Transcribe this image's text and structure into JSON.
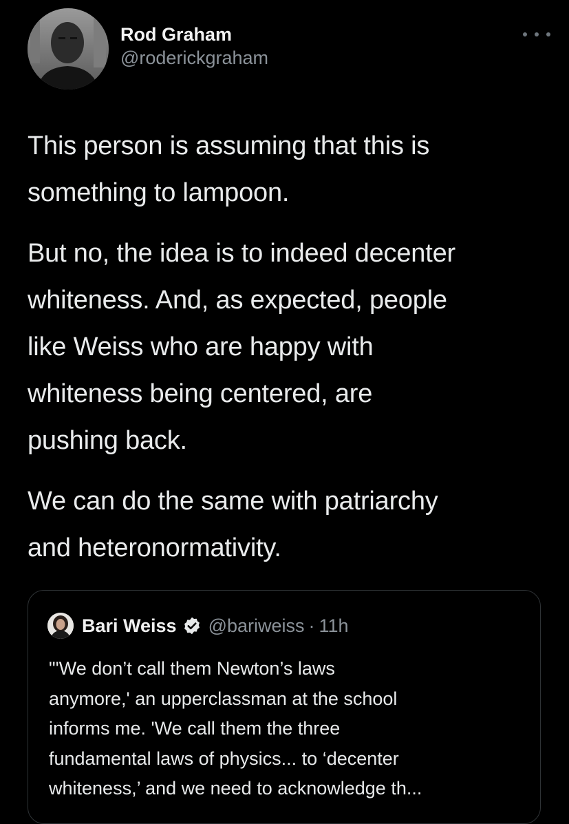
{
  "tweet": {
    "author": {
      "display_name": "Rod Graham",
      "handle": "@roderickgraham",
      "avatar_icon": "profile-photo"
    },
    "more_icon": "more-horizontal-icon",
    "paragraphs": [
      "This person is assuming that this is\nsomething to lampoon.",
      "But no, the idea is to indeed decenter\nwhiteness. And, as expected, people\nlike Weiss who are happy with\nwhiteness being centered, are\npushing back.",
      "We can do the same with patriarchy\nand heteronormativity."
    ]
  },
  "quoted_tweet": {
    "author": {
      "display_name": "Bari Weiss",
      "handle": "@bariweiss",
      "separator": "·",
      "time": "11h",
      "verified_icon": "verified-badge-icon"
    },
    "text": "\"'We don’t call them Newton’s laws\nanymore,' an upperclassman at the school\ninforms me. 'We call them the three\nfundamental laws of physics... to ‘decenter\nwhiteness,’ and we need to acknowledge th..."
  },
  "colors": {
    "background": "#000000",
    "primary_text": "#e7e9ea",
    "secondary_text": "#8b9299",
    "border": "#2f3336",
    "verified_badge": "#e7e9ea"
  }
}
